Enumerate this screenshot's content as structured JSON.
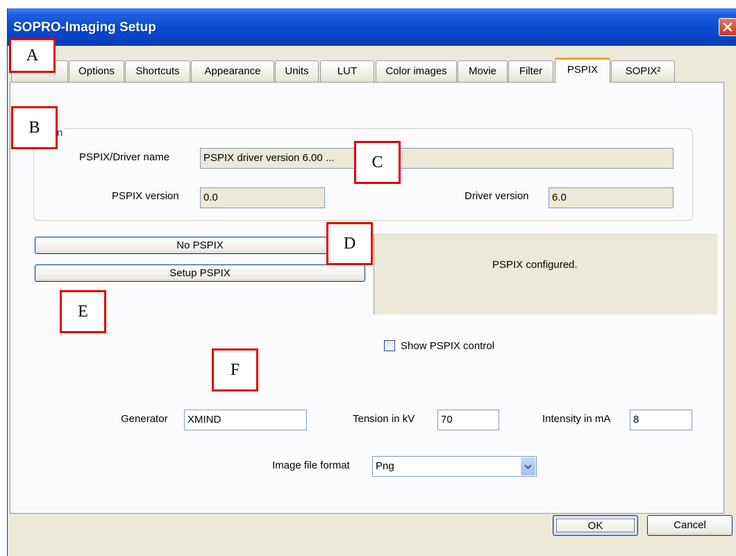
{
  "window": {
    "title": "SOPRO-Imaging Setup"
  },
  "tabs": [
    {
      "label": ""
    },
    {
      "label": "Options"
    },
    {
      "label": "Shortcuts"
    },
    {
      "label": "Appearance"
    },
    {
      "label": "Units"
    },
    {
      "label": "LUT"
    },
    {
      "label": "Color images"
    },
    {
      "label": "Movie"
    },
    {
      "label": "Filter"
    },
    {
      "label": "PSPIX"
    },
    {
      "label": "SOPIX²"
    }
  ],
  "active_tab": "PSPIX",
  "information": {
    "legend": "ormation",
    "driver_name_label": "PSPIX/Driver name",
    "driver_name_value": "PSPIX driver version 6.00 ...",
    "pspix_version_label": "PSPIX version",
    "pspix_version_value": "0.0",
    "driver_version_label": "Driver version",
    "driver_version_value": "6.0"
  },
  "buttons": {
    "no_pspix": "No PSPIX",
    "setup_pspix": "Setup PSPIX",
    "ok": "OK",
    "cancel": "Cancel"
  },
  "status": {
    "message": "PSPIX configured."
  },
  "show_control": {
    "label": "Show PSPIX control",
    "checked": false
  },
  "generator": {
    "label": "Generator",
    "value": "XMIND"
  },
  "tension": {
    "label": "Tension in kV",
    "value": "70"
  },
  "intensity": {
    "label": "Intensity in mA",
    "value": "8"
  },
  "image_format": {
    "label": "Image file format",
    "selected": "Png"
  },
  "annotations": {
    "a": "A",
    "b": "B",
    "c": "C",
    "d": "D",
    "e": "E",
    "f": "F"
  },
  "colors": {
    "title_bar": "#0a4ad0",
    "annotation_border": "#e00000",
    "active_tab_accent": "#f0a030"
  }
}
